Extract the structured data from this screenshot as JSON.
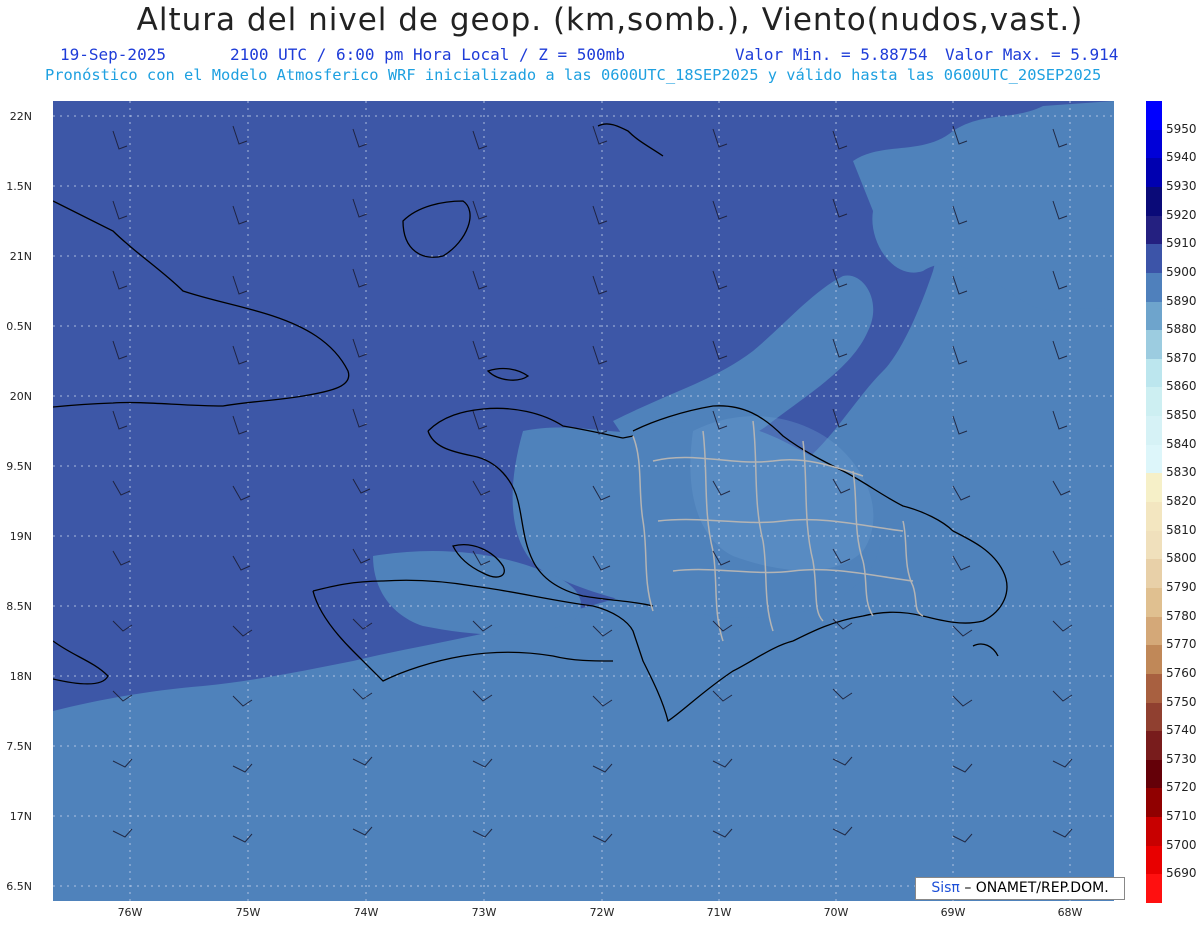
{
  "header": {
    "title": "Altura del nivel de geop. (km,somb.), Viento(nudos,vast.)",
    "date": "19-Sep-2025",
    "time": "2100 UTC / 6:00 pm Hora Local / Z = 500mb",
    "min": "Valor Min. = 5.88754",
    "max": "Valor Max. = 5.914",
    "forecast": "Pronóstico con el Modelo Atmosferico WRF inicializado a las 0600UTC_18SEP2025 y válido hasta las  0600UTC_20SEP2025"
  },
  "axes": {
    "lat_labels": [
      "22N",
      "1.5N",
      "21N",
      "0.5N",
      "20N",
      "9.5N",
      "19N",
      "8.5N",
      "18N",
      "7.5N",
      "17N",
      "6.5N"
    ],
    "lon_labels": [
      "76W",
      "75W",
      "74W",
      "73W",
      "72W",
      "71W",
      "70W",
      "69W",
      "68W"
    ]
  },
  "colorbar": {
    "levels": [
      "5950",
      "5940",
      "5930",
      "5920",
      "5910",
      "5900",
      "5890",
      "5880",
      "5870",
      "5860",
      "5850",
      "5840",
      "5830",
      "5820",
      "5810",
      "5800",
      "5790",
      "5780",
      "5770",
      "5760",
      "5750",
      "5740",
      "5730",
      "5720",
      "5710",
      "5700",
      "5690"
    ],
    "colors": [
      "#0000ff",
      "#0000d8",
      "#0000b0",
      "#0a0a78",
      "#242080",
      "#3c54a8",
      "#4f80bc",
      "#6ea4cc",
      "#9ccce0",
      "#bce6ee",
      "#cdeff2",
      "#d6f2f6",
      "#ddf6fa",
      "#f6f0c8",
      "#f3e6c0",
      "#f0e0bc",
      "#e8d0a8",
      "#e0c090",
      "#d4a878",
      "#c08858",
      "#a86040",
      "#904030",
      "#781c1c",
      "#640008",
      "#900000",
      "#c80000",
      "#e80000",
      "#ff1010"
    ],
    "fill_levels": {
      "base": "5900",
      "coastal": "5890",
      "land": "5880"
    }
  },
  "credit": {
    "logo": "Sisπ",
    "text": "– ONAMET/REP.DOM."
  }
}
